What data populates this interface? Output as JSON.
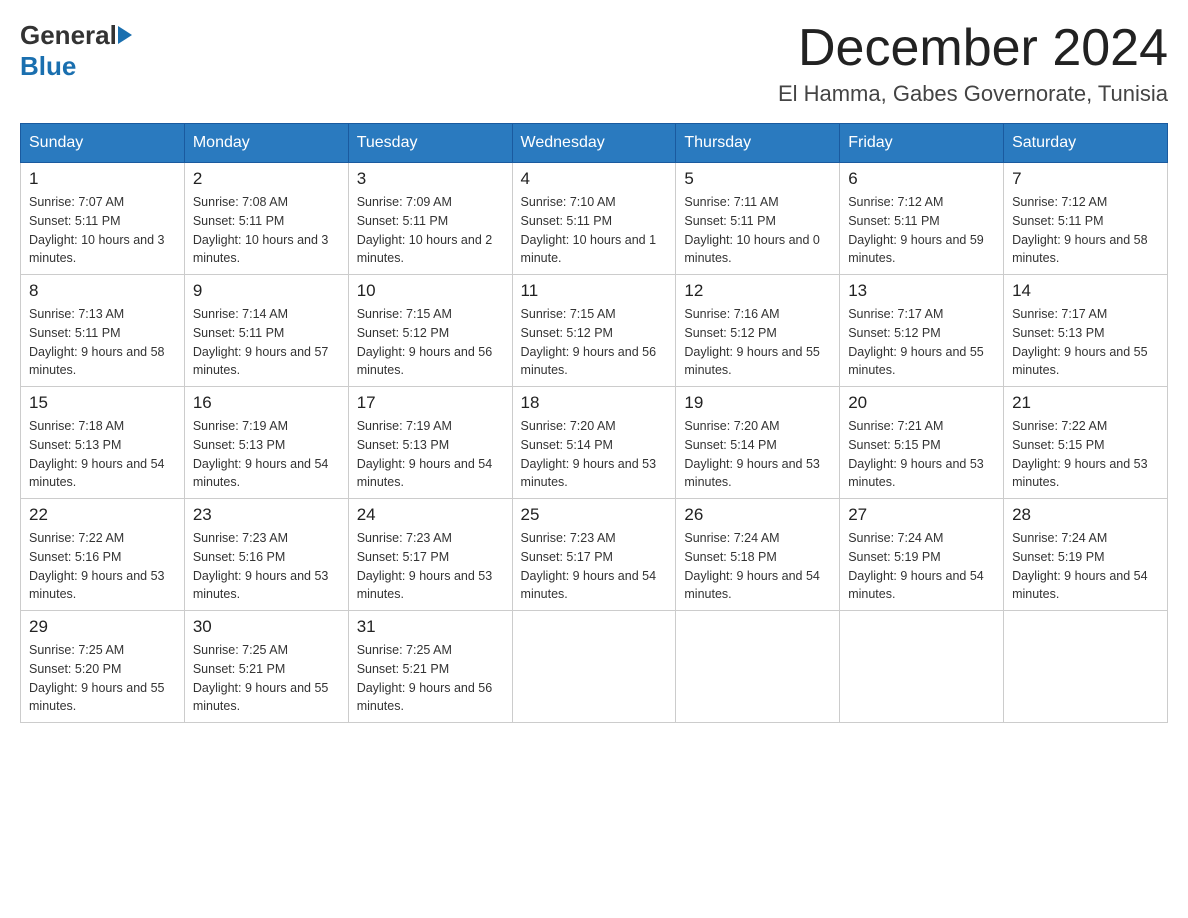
{
  "header": {
    "month_title": "December 2024",
    "location": "El Hamma, Gabes Governorate, Tunisia",
    "logo_general": "General",
    "logo_blue": "Blue"
  },
  "days_of_week": [
    "Sunday",
    "Monday",
    "Tuesday",
    "Wednesday",
    "Thursday",
    "Friday",
    "Saturday"
  ],
  "weeks": [
    [
      {
        "day": "1",
        "sunrise": "7:07 AM",
        "sunset": "5:11 PM",
        "daylight": "10 hours and 3 minutes."
      },
      {
        "day": "2",
        "sunrise": "7:08 AM",
        "sunset": "5:11 PM",
        "daylight": "10 hours and 3 minutes."
      },
      {
        "day": "3",
        "sunrise": "7:09 AM",
        "sunset": "5:11 PM",
        "daylight": "10 hours and 2 minutes."
      },
      {
        "day": "4",
        "sunrise": "7:10 AM",
        "sunset": "5:11 PM",
        "daylight": "10 hours and 1 minute."
      },
      {
        "day": "5",
        "sunrise": "7:11 AM",
        "sunset": "5:11 PM",
        "daylight": "10 hours and 0 minutes."
      },
      {
        "day": "6",
        "sunrise": "7:12 AM",
        "sunset": "5:11 PM",
        "daylight": "9 hours and 59 minutes."
      },
      {
        "day": "7",
        "sunrise": "7:12 AM",
        "sunset": "5:11 PM",
        "daylight": "9 hours and 58 minutes."
      }
    ],
    [
      {
        "day": "8",
        "sunrise": "7:13 AM",
        "sunset": "5:11 PM",
        "daylight": "9 hours and 58 minutes."
      },
      {
        "day": "9",
        "sunrise": "7:14 AM",
        "sunset": "5:11 PM",
        "daylight": "9 hours and 57 minutes."
      },
      {
        "day": "10",
        "sunrise": "7:15 AM",
        "sunset": "5:12 PM",
        "daylight": "9 hours and 56 minutes."
      },
      {
        "day": "11",
        "sunrise": "7:15 AM",
        "sunset": "5:12 PM",
        "daylight": "9 hours and 56 minutes."
      },
      {
        "day": "12",
        "sunrise": "7:16 AM",
        "sunset": "5:12 PM",
        "daylight": "9 hours and 55 minutes."
      },
      {
        "day": "13",
        "sunrise": "7:17 AM",
        "sunset": "5:12 PM",
        "daylight": "9 hours and 55 minutes."
      },
      {
        "day": "14",
        "sunrise": "7:17 AM",
        "sunset": "5:13 PM",
        "daylight": "9 hours and 55 minutes."
      }
    ],
    [
      {
        "day": "15",
        "sunrise": "7:18 AM",
        "sunset": "5:13 PM",
        "daylight": "9 hours and 54 minutes."
      },
      {
        "day": "16",
        "sunrise": "7:19 AM",
        "sunset": "5:13 PM",
        "daylight": "9 hours and 54 minutes."
      },
      {
        "day": "17",
        "sunrise": "7:19 AM",
        "sunset": "5:13 PM",
        "daylight": "9 hours and 54 minutes."
      },
      {
        "day": "18",
        "sunrise": "7:20 AM",
        "sunset": "5:14 PM",
        "daylight": "9 hours and 53 minutes."
      },
      {
        "day": "19",
        "sunrise": "7:20 AM",
        "sunset": "5:14 PM",
        "daylight": "9 hours and 53 minutes."
      },
      {
        "day": "20",
        "sunrise": "7:21 AM",
        "sunset": "5:15 PM",
        "daylight": "9 hours and 53 minutes."
      },
      {
        "day": "21",
        "sunrise": "7:22 AM",
        "sunset": "5:15 PM",
        "daylight": "9 hours and 53 minutes."
      }
    ],
    [
      {
        "day": "22",
        "sunrise": "7:22 AM",
        "sunset": "5:16 PM",
        "daylight": "9 hours and 53 minutes."
      },
      {
        "day": "23",
        "sunrise": "7:23 AM",
        "sunset": "5:16 PM",
        "daylight": "9 hours and 53 minutes."
      },
      {
        "day": "24",
        "sunrise": "7:23 AM",
        "sunset": "5:17 PM",
        "daylight": "9 hours and 53 minutes."
      },
      {
        "day": "25",
        "sunrise": "7:23 AM",
        "sunset": "5:17 PM",
        "daylight": "9 hours and 54 minutes."
      },
      {
        "day": "26",
        "sunrise": "7:24 AM",
        "sunset": "5:18 PM",
        "daylight": "9 hours and 54 minutes."
      },
      {
        "day": "27",
        "sunrise": "7:24 AM",
        "sunset": "5:19 PM",
        "daylight": "9 hours and 54 minutes."
      },
      {
        "day": "28",
        "sunrise": "7:24 AM",
        "sunset": "5:19 PM",
        "daylight": "9 hours and 54 minutes."
      }
    ],
    [
      {
        "day": "29",
        "sunrise": "7:25 AM",
        "sunset": "5:20 PM",
        "daylight": "9 hours and 55 minutes."
      },
      {
        "day": "30",
        "sunrise": "7:25 AM",
        "sunset": "5:21 PM",
        "daylight": "9 hours and 55 minutes."
      },
      {
        "day": "31",
        "sunrise": "7:25 AM",
        "sunset": "5:21 PM",
        "daylight": "9 hours and 56 minutes."
      },
      null,
      null,
      null,
      null
    ]
  ],
  "labels": {
    "sunrise": "Sunrise:",
    "sunset": "Sunset:",
    "daylight": "Daylight:"
  }
}
